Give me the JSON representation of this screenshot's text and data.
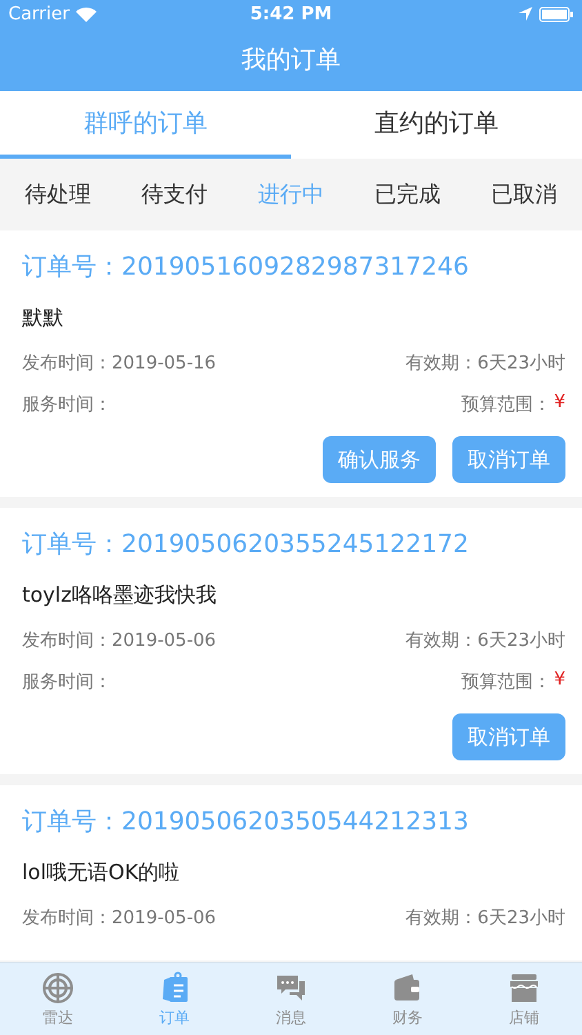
{
  "status_bar": {
    "carrier": "Carrier",
    "time": "5:42 PM"
  },
  "nav": {
    "title": "我的订单"
  },
  "tabs": [
    {
      "label": "群呼的订单",
      "selected": true
    },
    {
      "label": "直约的订单",
      "selected": false
    }
  ],
  "filters": [
    {
      "label": "待处理",
      "selected": false
    },
    {
      "label": "待支付",
      "selected": false
    },
    {
      "label": "进行中",
      "selected": true
    },
    {
      "label": "已完成",
      "selected": false
    },
    {
      "label": "已取消",
      "selected": false
    }
  ],
  "orders": [
    {
      "order_no": "订单号：2019051609282987317246",
      "name": "默默",
      "publish_time": "发布时间：2019-05-16",
      "validity": "有效期：6天23小时",
      "service_time": "服务时间：",
      "budget_label": "预算范围：",
      "budget": "¥",
      "buttons": [
        "确认服务",
        "取消订单"
      ]
    },
    {
      "order_no": "订单号：2019050620355245122172",
      "name": "toylz咯咯墨迹我快我",
      "publish_time": "发布时间：2019-05-06",
      "validity": "有效期：6天23小时",
      "service_time": "服务时间：",
      "budget_label": "预算范围：",
      "budget": "¥",
      "buttons": [
        "取消订单"
      ]
    },
    {
      "order_no": "订单号：2019050620350544212313",
      "name": "lol哦无语OK的啦",
      "publish_time": "发布时间：2019-05-06",
      "validity": "有效期：6天23小时"
    }
  ],
  "tab_bar": [
    {
      "label": "雷达",
      "kind": "radar",
      "selected": false
    },
    {
      "label": "订单",
      "kind": "orders",
      "selected": true
    },
    {
      "label": "消息",
      "kind": "messages",
      "selected": false
    },
    {
      "label": "财务",
      "kind": "wallet",
      "selected": false
    },
    {
      "label": "店铺",
      "kind": "shop",
      "selected": false
    }
  ]
}
